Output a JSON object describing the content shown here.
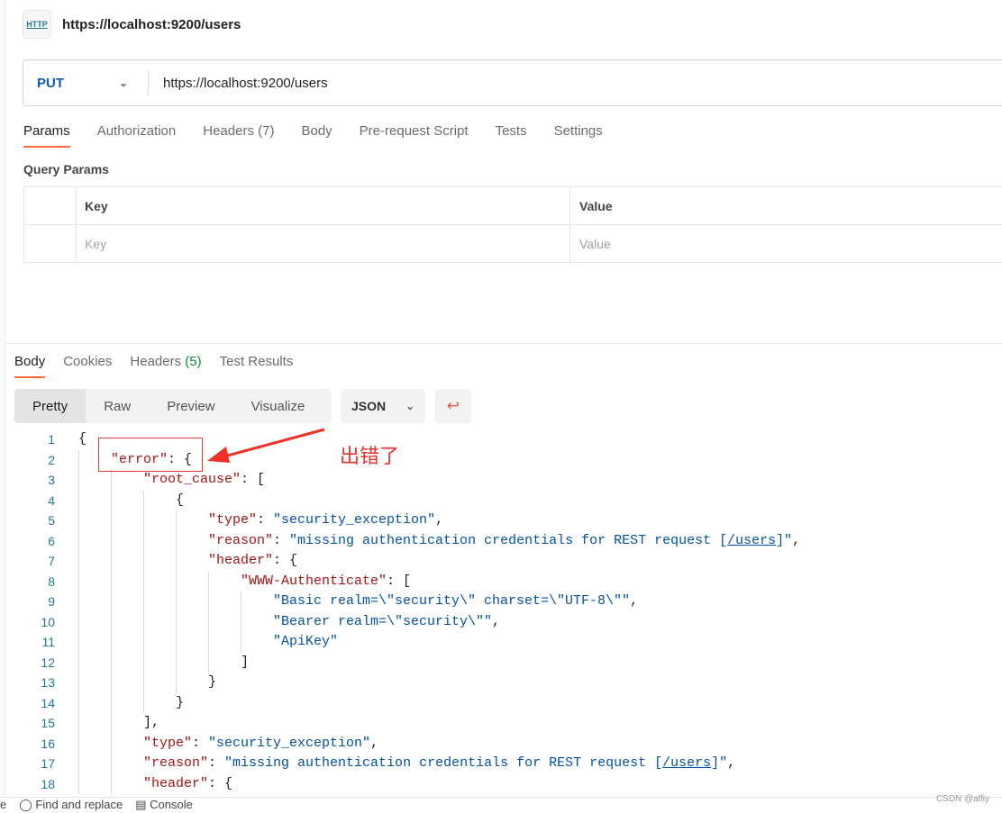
{
  "title": "https://localhost:9200/users",
  "request": {
    "method": "PUT",
    "url": "https://localhost:9200/users"
  },
  "req_tabs": [
    {
      "label": "Params",
      "active": true
    },
    {
      "label": "Authorization"
    },
    {
      "label": "Headers",
      "count": "(7)"
    },
    {
      "label": "Body"
    },
    {
      "label": "Pre-request Script"
    },
    {
      "label": "Tests"
    },
    {
      "label": "Settings"
    }
  ],
  "query_params": {
    "title": "Query Params",
    "headers": [
      "Key",
      "Value"
    ],
    "placeholders": [
      "Key",
      "Value"
    ]
  },
  "resp_tabs": [
    {
      "label": "Body",
      "active": true
    },
    {
      "label": "Cookies"
    },
    {
      "label": "Headers",
      "count": "(5)"
    },
    {
      "label": "Test Results"
    }
  ],
  "view_modes": [
    "Pretty",
    "Raw",
    "Preview",
    "Visualize"
  ],
  "format": "JSON",
  "accent": "#ff6c37",
  "annotation": "出错了",
  "code": [
    {
      "i": 0,
      "t": [
        [
          "p",
          "{"
        ]
      ]
    },
    {
      "i": 1,
      "t": [
        [
          "k",
          "\"error\""
        ],
        [
          "p",
          ": {"
        ]
      ]
    },
    {
      "i": 2,
      "t": [
        [
          "k",
          "\"root_cause\""
        ],
        [
          "p",
          ": ["
        ]
      ]
    },
    {
      "i": 3,
      "t": [
        [
          "p",
          "{"
        ]
      ]
    },
    {
      "i": 4,
      "t": [
        [
          "k",
          "\"type\""
        ],
        [
          "p",
          ": "
        ],
        [
          "s",
          "\"security_exception\""
        ],
        [
          "p",
          ","
        ]
      ]
    },
    {
      "i": 4,
      "t": [
        [
          "k",
          "\"reason\""
        ],
        [
          "p",
          ": "
        ],
        [
          "s",
          "\"missing authentication credentials for REST request ["
        ],
        [
          "l",
          "/users"
        ],
        [
          "s",
          "]\""
        ],
        [
          "p",
          ","
        ]
      ]
    },
    {
      "i": 4,
      "t": [
        [
          "k",
          "\"header\""
        ],
        [
          "p",
          ": {"
        ]
      ]
    },
    {
      "i": 5,
      "t": [
        [
          "k",
          "\"WWW-Authenticate\""
        ],
        [
          "p",
          ": ["
        ]
      ]
    },
    {
      "i": 6,
      "t": [
        [
          "s",
          "\"Basic realm=\\\"security\\\" charset=\\\"UTF-8\\\"\""
        ],
        [
          "p",
          ","
        ]
      ]
    },
    {
      "i": 6,
      "t": [
        [
          "s",
          "\"Bearer realm=\\\"security\\\"\""
        ],
        [
          "p",
          ","
        ]
      ]
    },
    {
      "i": 6,
      "t": [
        [
          "s",
          "\"ApiKey\""
        ]
      ]
    },
    {
      "i": 5,
      "t": [
        [
          "p",
          "]"
        ]
      ]
    },
    {
      "i": 4,
      "t": [
        [
          "p",
          "}"
        ]
      ]
    },
    {
      "i": 3,
      "t": [
        [
          "p",
          "}"
        ]
      ]
    },
    {
      "i": 2,
      "t": [
        [
          "p",
          "],"
        ]
      ]
    },
    {
      "i": 2,
      "t": [
        [
          "k",
          "\"type\""
        ],
        [
          "p",
          ": "
        ],
        [
          "s",
          "\"security_exception\""
        ],
        [
          "p",
          ","
        ]
      ]
    },
    {
      "i": 2,
      "t": [
        [
          "k",
          "\"reason\""
        ],
        [
          "p",
          ": "
        ],
        [
          "s",
          "\"missing authentication credentials for REST request ["
        ],
        [
          "l",
          "/users"
        ],
        [
          "s",
          "]\""
        ],
        [
          "p",
          ","
        ]
      ]
    },
    {
      "i": 2,
      "t": [
        [
          "k",
          "\"header\""
        ],
        [
          "p",
          ": {"
        ]
      ]
    }
  ],
  "statusbar": {
    "find": "Find and replace",
    "console": "Console",
    "partial": "e"
  },
  "watermark": "CSDN @alfiy"
}
